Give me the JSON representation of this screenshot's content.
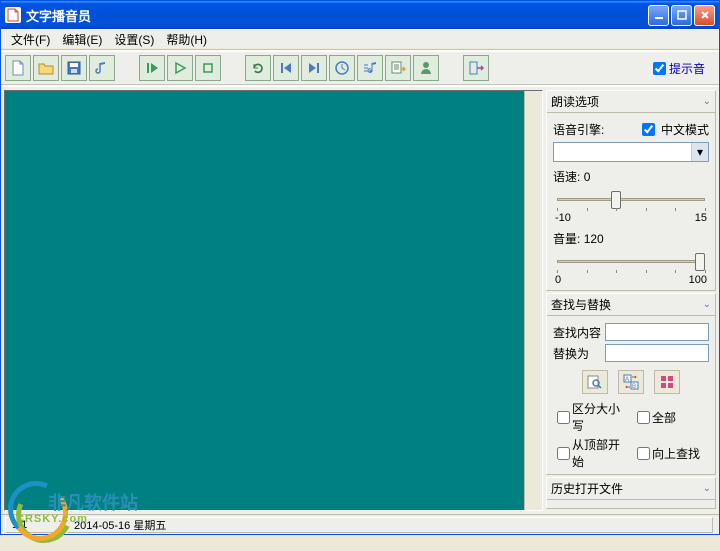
{
  "title": "文字播音员",
  "menu": {
    "file": "文件(F)",
    "edit": "编辑(E)",
    "settings": "设置(S)",
    "help": "帮助(H)"
  },
  "toolbar": {
    "hint_sound_label": "提示音",
    "hint_sound_checked": true
  },
  "read_options": {
    "header": "朗读选项",
    "engine_label": "语音引擎:",
    "chinese_mode_label": "中文模式",
    "chinese_mode_checked": true,
    "engine_value": "",
    "speed_label": "语速:",
    "speed_value": "0",
    "speed_min": "-10",
    "speed_max": "15",
    "volume_label": "音量:",
    "volume_value": "120",
    "volume_min": "0",
    "volume_max": "100"
  },
  "find_replace": {
    "header": "查找与替换",
    "find_label": "查找内容",
    "replace_label": "替换为",
    "find_value": "",
    "replace_value": "",
    "case_label": "区分大小写",
    "all_label": "全部",
    "from_top_label": "从顶部开始",
    "up_label": "向上查找"
  },
  "history": {
    "header": "历史打开文件"
  },
  "status": {
    "cursor": "1:1",
    "date": "2014-05-16 星期五"
  },
  "watermark": {
    "text": "非凡软件站",
    "sub": "CRSKY.com"
  }
}
